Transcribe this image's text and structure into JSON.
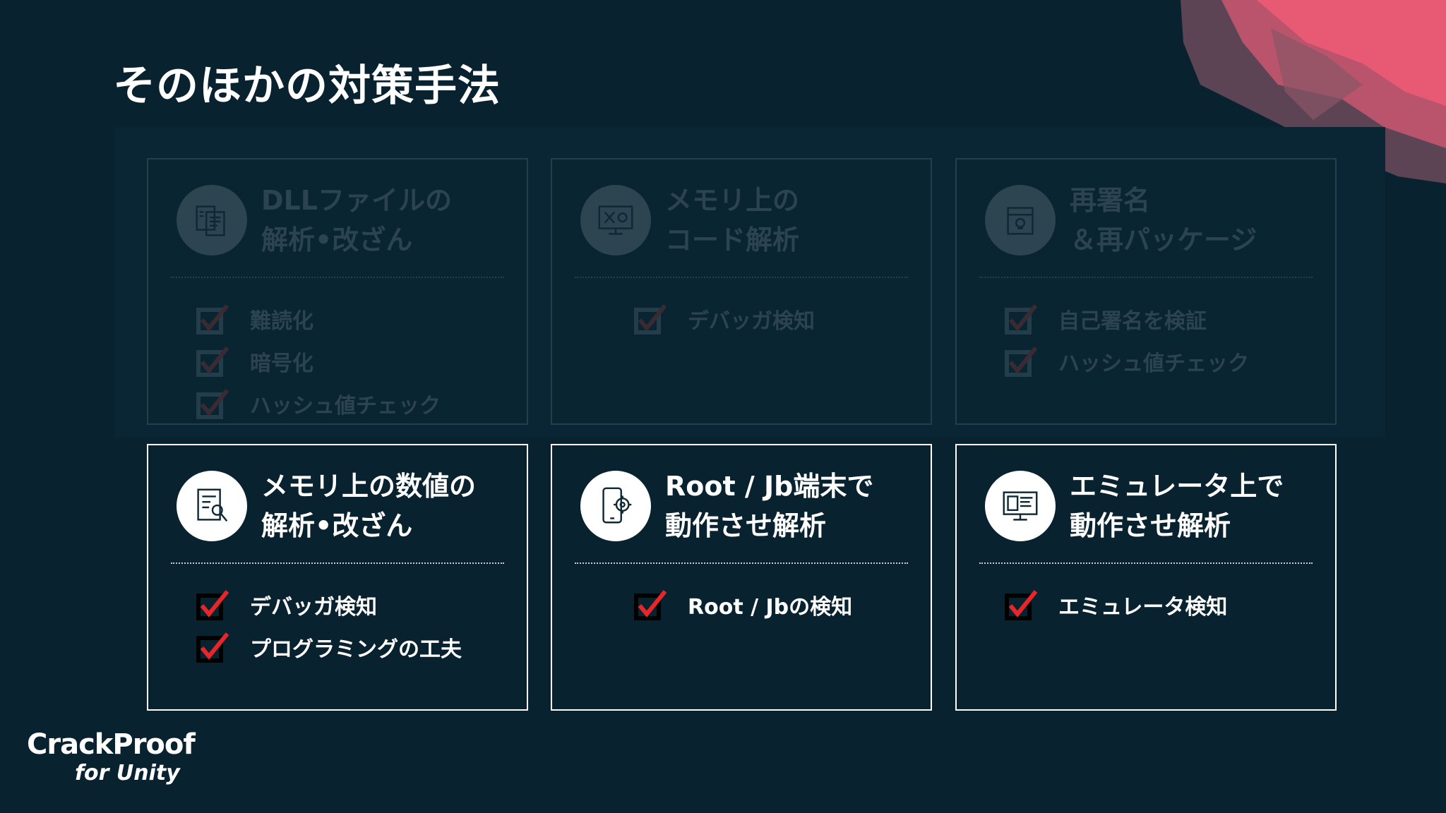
{
  "title": "そのほかの対策手法",
  "colors": {
    "background": "#08222f",
    "check_red": "#e8262a",
    "card_border": "#ffffff",
    "accent_pink": "#e05a73"
  },
  "cards_top": [
    {
      "icon": "document-code-icon",
      "title": "DLLファイルの\n解析•改ざん",
      "items": [
        "難読化",
        "暗号化",
        "ハッシュ値チェック"
      ]
    },
    {
      "icon": "monitor-tools-icon",
      "title": "メモリ上の\nコード解析",
      "items": [
        "デバッガ検知"
      ]
    },
    {
      "icon": "package-skull-icon",
      "title": "再署名\n＆再パッケージ",
      "items": [
        "自己署名を検証",
        "ハッシュ値チェック"
      ]
    }
  ],
  "cards_bottom": [
    {
      "icon": "document-wrench-icon",
      "title": "メモリ上の数値の\n解析•改ざん",
      "items": [
        "デバッガ検知",
        "プログラミングの工夫"
      ]
    },
    {
      "icon": "phone-gear-icon",
      "title": "Root / Jb端末で\n動作させ解析",
      "items": [
        "Root / Jbの検知"
      ]
    },
    {
      "icon": "desktop-monitor-icon",
      "title": "エミュレータ上で\n動作させ解析",
      "items": [
        "エミュレータ検知"
      ]
    }
  ],
  "logo": {
    "main": "CrackProof",
    "sub": "for Unity"
  }
}
